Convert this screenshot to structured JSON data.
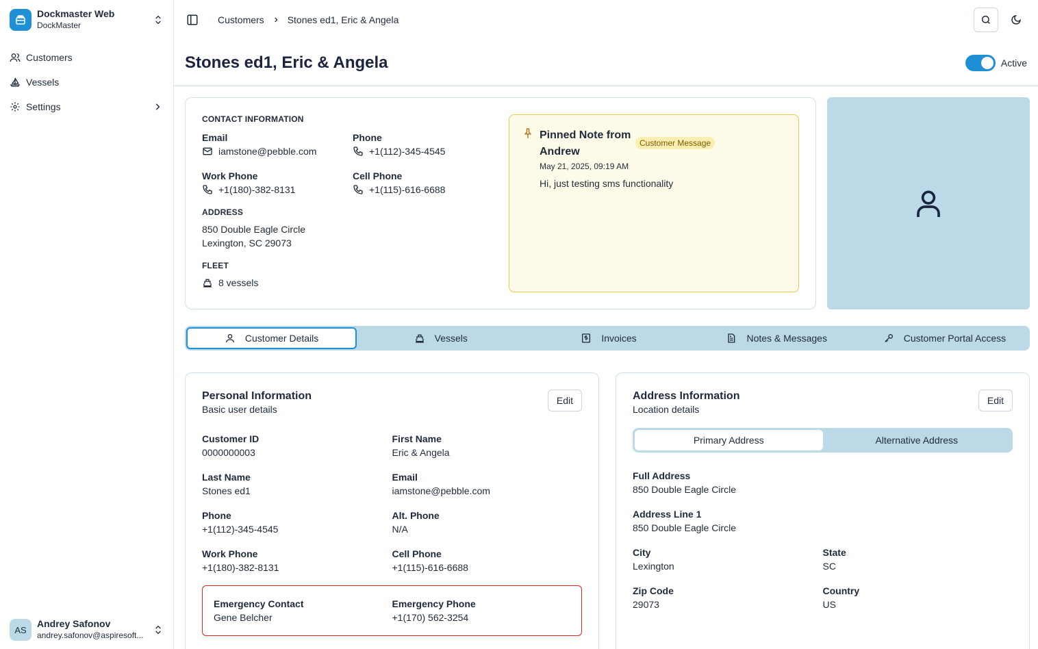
{
  "app": {
    "name": "Dockmaster Web",
    "sub": "DockMaster"
  },
  "sidebar": {
    "items": [
      {
        "label": "Customers",
        "icon": "users-icon"
      },
      {
        "label": "Vessels",
        "icon": "sailboat-icon"
      },
      {
        "label": "Settings",
        "icon": "gear-icon"
      }
    ]
  },
  "user": {
    "initials": "AS",
    "name": "Andrey Safonov",
    "email": "andrey.safonov@aspiresoft..."
  },
  "breadcrumb": {
    "parent": "Customers",
    "current": "Stones ed1, Eric & Angela"
  },
  "page": {
    "title": "Stones ed1, Eric & Angela",
    "status_label": "Active",
    "status_on": true
  },
  "contact": {
    "section_title": "CONTACT INFORMATION",
    "email_label": "Email",
    "email": "iamstone@pebble.com",
    "phone_label": "Phone",
    "phone": "+1(112)-345-4545",
    "work_phone_label": "Work Phone",
    "work_phone": "+1(180)-382-8131",
    "cell_phone_label": "Cell Phone",
    "cell_phone": "+1(115)-616-6688",
    "address_title": "ADDRESS",
    "address_line1": "850 Double Eagle Circle",
    "address_line2": "Lexington, SC 29073",
    "fleet_title": "FLEET",
    "fleet_value": "8 vessels"
  },
  "pinned": {
    "title": "Pinned Note from Andrew",
    "badge": "Customer Message",
    "date": "May 21, 2025, 09:19 AM",
    "body": "Hi, just testing sms functionality"
  },
  "tabs": [
    {
      "label": "Customer Details",
      "icon": "user-icon"
    },
    {
      "label": "Vessels",
      "icon": "boat-icon"
    },
    {
      "label": "Invoices",
      "icon": "invoice-icon"
    },
    {
      "label": "Notes & Messages",
      "icon": "document-icon"
    },
    {
      "label": "Customer Portal Access",
      "icon": "key-icon"
    }
  ],
  "personal": {
    "title": "Personal Information",
    "subtitle": "Basic user details",
    "edit_label": "Edit",
    "fields": [
      {
        "label": "Customer ID",
        "value": "0000000003"
      },
      {
        "label": "First Name",
        "value": "Eric & Angela"
      },
      {
        "label": "Last Name",
        "value": "Stones ed1"
      },
      {
        "label": "Email",
        "value": "iamstone@pebble.com"
      },
      {
        "label": "Phone",
        "value": "+1(112)-345-4545"
      },
      {
        "label": "Alt. Phone",
        "value": "N/A"
      },
      {
        "label": "Work Phone",
        "value": "+1(180)-382-8131"
      },
      {
        "label": "Cell Phone",
        "value": "+1(115)-616-6688"
      }
    ],
    "emergency": [
      {
        "label": "Emergency Contact",
        "value": "Gene Belcher"
      },
      {
        "label": "Emergency Phone",
        "value": "+1(170) 562-3254"
      }
    ]
  },
  "address": {
    "title": "Address Information",
    "subtitle": "Location details",
    "edit_label": "Edit",
    "tabs": [
      "Primary Address",
      "Alternative Address"
    ],
    "full_label": "Full Address",
    "full": "850 Double Eagle Circle",
    "line1_label": "Address Line 1",
    "line1": "850 Double Eagle Circle",
    "fields": [
      {
        "label": "City",
        "value": "Lexington"
      },
      {
        "label": "State",
        "value": "SC"
      },
      {
        "label": "Zip Code",
        "value": "29073"
      },
      {
        "label": "Country",
        "value": "US"
      }
    ]
  },
  "colors": {
    "accent": "#1f8fd6",
    "light_blue": "#bcd9e8",
    "note_bg": "#fefbe8",
    "danger": "#dc2626"
  }
}
